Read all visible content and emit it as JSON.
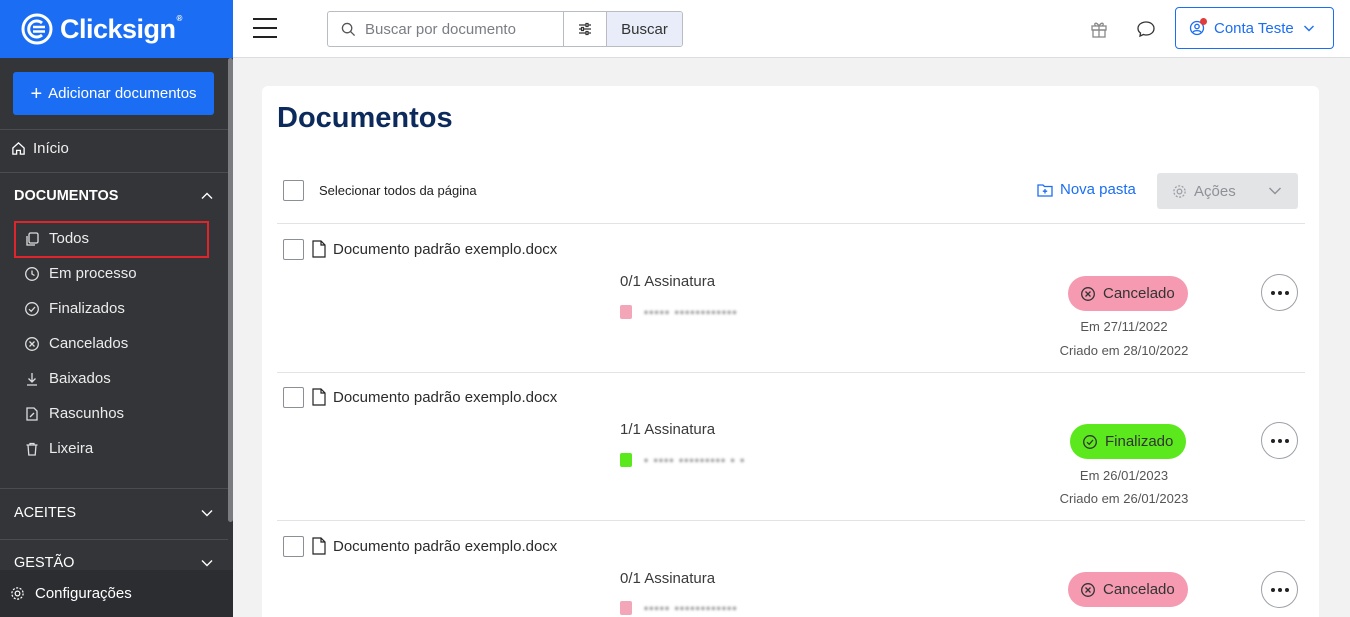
{
  "brand": {
    "name": "Clicksign",
    "mark": "®"
  },
  "sidebar": {
    "add_button": "Adicionar documentos",
    "home": "Início",
    "documentos": {
      "title": "DOCUMENTOS",
      "items": [
        {
          "label": "Todos",
          "icon": "copy-icon"
        },
        {
          "label": "Em processo",
          "icon": "clock-icon"
        },
        {
          "label": "Finalizados",
          "icon": "check-circle-icon"
        },
        {
          "label": "Cancelados",
          "icon": "x-circle-icon"
        },
        {
          "label": "Baixados",
          "icon": "download-icon"
        },
        {
          "label": "Rascunhos",
          "icon": "draft-icon"
        },
        {
          "label": "Lixeira",
          "icon": "trash-icon"
        }
      ]
    },
    "aceites": "ACEITES",
    "gestao": "GESTÃO",
    "config": "Configurações"
  },
  "topbar": {
    "search_placeholder": "Buscar por documento",
    "search_button": "Buscar",
    "account": "Conta Teste"
  },
  "main": {
    "title": "Documentos",
    "select_all": "Selecionar todos da página",
    "new_folder": "Nova pasta",
    "actions": "Ações",
    "documents": [
      {
        "name": "Documento padrão exemplo.docx",
        "signatures": "0/1 Assinatura",
        "status": "Cancelado",
        "status_color": "#f59ab0",
        "date": "Em 27/11/2022",
        "created": "Criado em 28/10/2022"
      },
      {
        "name": "Documento padrão exemplo.docx",
        "signatures": "1/1 Assinatura",
        "status": "Finalizado",
        "status_color": "#5be81c",
        "date": "Em 26/01/2023",
        "created": "Criado em 26/01/2023"
      },
      {
        "name": "Documento padrão exemplo.docx",
        "signatures": "0/1 Assinatura",
        "status": "Cancelado",
        "status_color": "#f59ab0"
      }
    ]
  },
  "colors": {
    "brand_blue": "#1b6ef3",
    "sidebar_bg": "#333538",
    "title_navy": "#0c2a5b",
    "highlight_red": "#e0242b"
  }
}
